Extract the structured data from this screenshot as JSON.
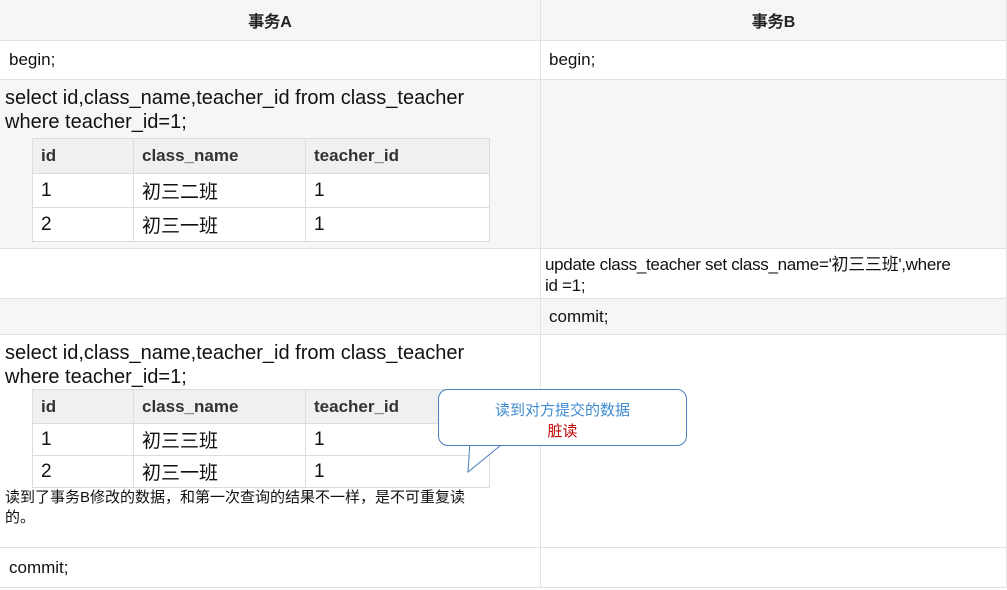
{
  "header": {
    "col_a": "事务A",
    "col_b": "事务B"
  },
  "steps": {
    "begin_a": "begin;",
    "begin_b": "begin;",
    "select1_line1": "select id,class_name,teacher_id  from class_teacher",
    "select1_line2": "where teacher_id=1;",
    "update_line1": "update class_teacher set class_name='初三三班',where",
    "update_line2": "id =1;",
    "commit_b": "commit;",
    "select2_line1": "select id,class_name,teacher_id  from class_teacher",
    "select2_line2": "where teacher_id=1;",
    "note_line1": "读到了事务B修改的数据，和第一次查询的结果不一样，是不可重复读",
    "note_line2": "的。",
    "commit_a": "commit;"
  },
  "result1": {
    "columns": [
      "id",
      "class_name",
      "teacher_id"
    ],
    "rows": [
      [
        "1",
        "初三二班",
        "1"
      ],
      [
        "2",
        "初三一班",
        "1"
      ]
    ]
  },
  "result2": {
    "columns": [
      "id",
      "class_name",
      "teacher_id"
    ],
    "rows": [
      [
        "1",
        "初三三班",
        "1"
      ],
      [
        "2",
        "初三一班",
        "1"
      ]
    ]
  },
  "callout": {
    "line1": "读到对方提交的数据",
    "line2": "脏读"
  },
  "colors": {
    "callout_border": "#4a7fbd",
    "callout_text": "#3f8bd0",
    "callout_emphasis": "#c00000",
    "row_grey": "#f5f6f7"
  }
}
